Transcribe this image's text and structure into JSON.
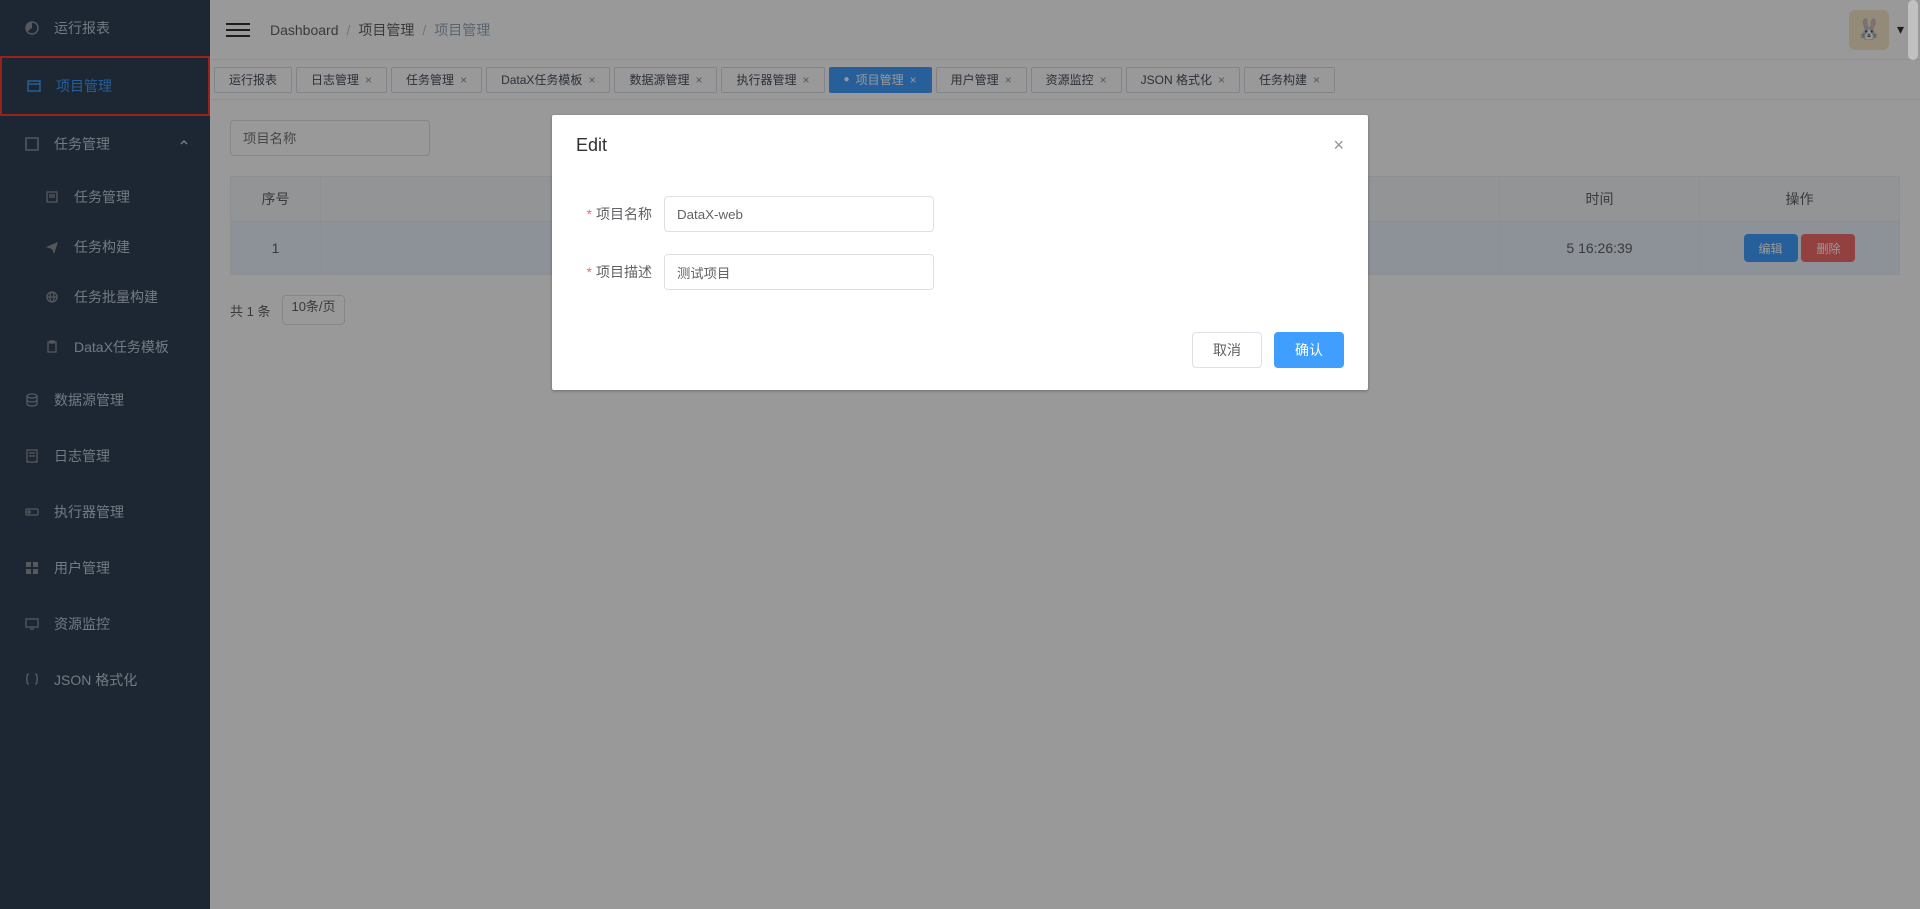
{
  "sidebar": {
    "items": [
      {
        "label": "运行报表"
      },
      {
        "label": "项目管理"
      },
      {
        "label": "任务管理"
      },
      {
        "label": "任务管理"
      },
      {
        "label": "任务构建"
      },
      {
        "label": "任务批量构建"
      },
      {
        "label": "DataX任务模板"
      },
      {
        "label": "数据源管理"
      },
      {
        "label": "日志管理"
      },
      {
        "label": "执行器管理"
      },
      {
        "label": "用户管理"
      },
      {
        "label": "资源监控"
      },
      {
        "label": "JSON 格式化"
      }
    ]
  },
  "breadcrumb": {
    "root": "Dashboard",
    "p1": "项目管理",
    "p2": "项目管理"
  },
  "tabs": [
    {
      "label": "运行报表"
    },
    {
      "label": "日志管理"
    },
    {
      "label": "任务管理"
    },
    {
      "label": "DataX任务模板"
    },
    {
      "label": "数据源管理"
    },
    {
      "label": "执行器管理"
    },
    {
      "label": "项目管理",
      "active": true
    },
    {
      "label": "用户管理"
    },
    {
      "label": "资源监控"
    },
    {
      "label": "JSON 格式化"
    },
    {
      "label": "任务构建"
    }
  ],
  "search": {
    "placeholder": "项目名称"
  },
  "table": {
    "headers": {
      "seq": "序号",
      "time": "时间",
      "action": "操作"
    },
    "row": {
      "seq": "1",
      "time": "5 16:26:39",
      "edit": "编辑",
      "remove": "删除"
    }
  },
  "pagination": {
    "total_text": "共 1 条",
    "page_size": "10条/页"
  },
  "dialog": {
    "title": "Edit",
    "name_label": "项目名称",
    "name_value": "DataX-web",
    "desc_label": "项目描述",
    "desc_value": "测试项目",
    "cancel": "取消",
    "confirm": "确认"
  }
}
